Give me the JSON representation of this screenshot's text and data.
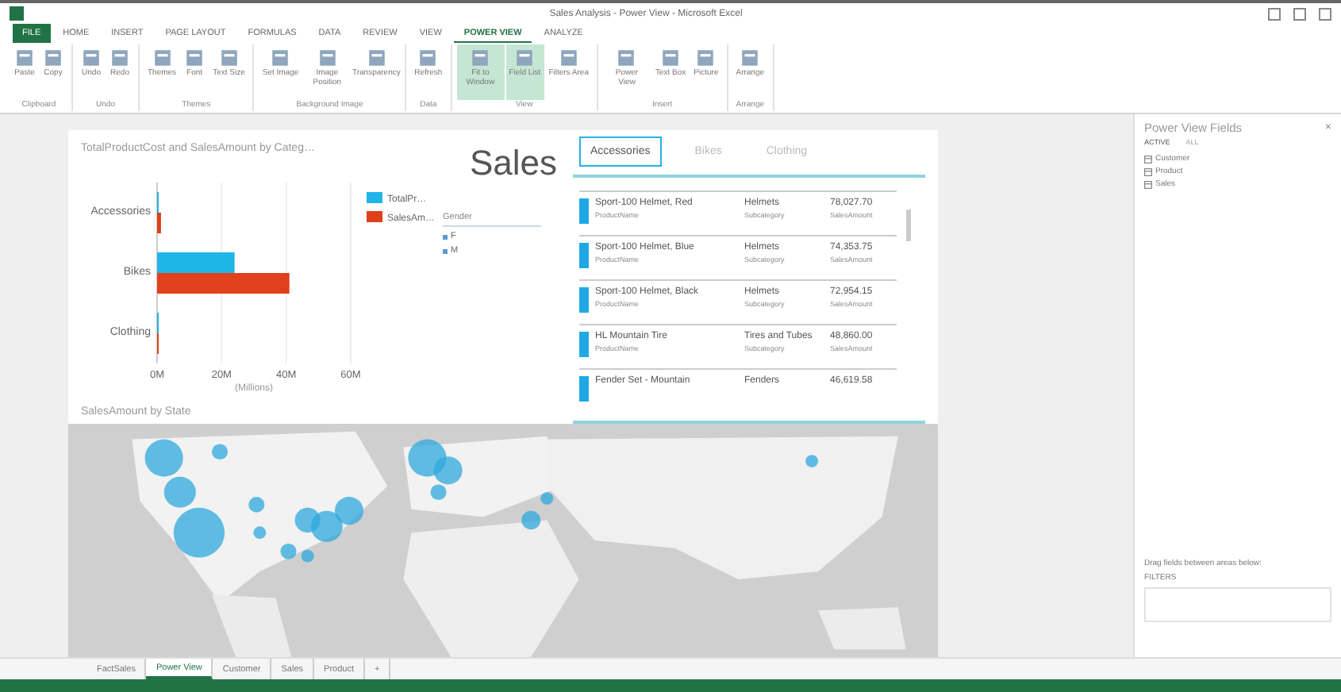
{
  "window": {
    "title": "Sales Analysis - Power View - Microsoft Excel"
  },
  "ribbon_tabs": [
    {
      "label": "FILE",
      "selected": false,
      "kind": "file"
    },
    {
      "label": "HOME",
      "selected": false,
      "kind": "tab"
    },
    {
      "label": "INSERT",
      "selected": false,
      "kind": "tab"
    },
    {
      "label": "PAGE LAYOUT",
      "selected": false,
      "kind": "tab"
    },
    {
      "label": "FORMULAS",
      "selected": false,
      "kind": "tab"
    },
    {
      "label": "DATA",
      "selected": false,
      "kind": "tab"
    },
    {
      "label": "REVIEW",
      "selected": false,
      "kind": "tab"
    },
    {
      "label": "VIEW",
      "selected": false,
      "kind": "tab"
    },
    {
      "label": "POWER VIEW",
      "selected": true,
      "kind": "tab"
    },
    {
      "label": "ANALYZE",
      "selected": false,
      "kind": "tab"
    }
  ],
  "ribbon_groups": [
    {
      "name": "Clipboard",
      "buttons": [
        {
          "label": "Paste",
          "on": false
        },
        {
          "label": "Copy",
          "on": false
        }
      ]
    },
    {
      "name": "Undo",
      "buttons": [
        {
          "label": "Undo",
          "on": false
        },
        {
          "label": "Redo",
          "on": false
        }
      ]
    },
    {
      "name": "Themes",
      "buttons": [
        {
          "label": "Themes",
          "on": false
        },
        {
          "label": "Font",
          "on": false
        },
        {
          "label": "Text Size",
          "on": false
        }
      ]
    },
    {
      "name": "Background Image",
      "buttons": [
        {
          "label": "Set Image",
          "on": false
        },
        {
          "label": "Image Position",
          "on": false
        },
        {
          "label": "Transparency",
          "on": false
        }
      ]
    },
    {
      "name": "Data",
      "buttons": [
        {
          "label": "Refresh",
          "on": false
        }
      ]
    },
    {
      "name": "View",
      "buttons": [
        {
          "label": "Fit to Window",
          "on": true
        },
        {
          "label": "Field List",
          "on": true
        },
        {
          "label": "Filters Area",
          "on": false
        }
      ]
    },
    {
      "name": "Insert",
      "buttons": [
        {
          "label": "Power View",
          "on": false
        },
        {
          "label": "Text Box",
          "on": false
        },
        {
          "label": "Picture",
          "on": false
        }
      ]
    },
    {
      "name": "Arrange",
      "buttons": [
        {
          "label": "Arrange",
          "on": false
        }
      ]
    }
  ],
  "report": {
    "title": "Sales",
    "bar_chart": {
      "chart_data": {
        "type": "bar",
        "orientation": "horizontal",
        "title": "TotalProductCost and SalesAmount by Categ…",
        "xlabel": "(Millions)",
        "categories": [
          "Accessories",
          "Bikes",
          "Clothing"
        ],
        "series": [
          {
            "name": "TotalPr…",
            "color": "#1fb5e8",
            "values": [
              0.5,
              24,
              0.3
            ]
          },
          {
            "name": "SalesAm…",
            "color": "#e0401c",
            "values": [
              1.2,
              41,
              0.4
            ]
          }
        ],
        "xlim": [
          0,
          60
        ],
        "xticks": [
          {
            "value": 0,
            "label": "0M"
          },
          {
            "value": 20,
            "label": "20M"
          },
          {
            "value": 40,
            "label": "40M"
          },
          {
            "value": 60,
            "label": "60M"
          }
        ],
        "legend": "right"
      }
    },
    "slicer": {
      "title": "Gender",
      "items": [
        {
          "label": "F",
          "selected": false
        },
        {
          "label": "M",
          "selected": false
        }
      ]
    },
    "tile_tabs": [
      {
        "label": "Accessories",
        "selected": true
      },
      {
        "label": "Bikes",
        "selected": false
      },
      {
        "label": "Clothing",
        "selected": false
      }
    ],
    "cards": [
      {
        "name": "Sport-100 Helmet, Red",
        "category": "Helmets",
        "amount": "78,027.70",
        "captions": [
          "ProductName",
          "Subcategory",
          "SalesAmount"
        ]
      },
      {
        "name": "Sport-100 Helmet, Blue",
        "category": "Helmets",
        "amount": "74,353.75",
        "captions": [
          "ProductName",
          "Subcategory",
          "SalesAmount"
        ]
      },
      {
        "name": "Sport-100 Helmet, Black",
        "category": "Helmets",
        "amount": "72,954.15",
        "captions": [
          "ProductName",
          "Subcategory",
          "SalesAmount"
        ]
      },
      {
        "name": "HL Mountain Tire",
        "category": "Tires and Tubes",
        "amount": "48,860.00",
        "captions": [
          "ProductName",
          "Subcategory",
          "SalesAmount"
        ]
      },
      {
        "name": "Fender Set - Mountain",
        "category": "Fenders",
        "amount": "46,619.58"
      }
    ],
    "map": {
      "title": "SalesAmount by State",
      "kind": "picture"
    }
  },
  "field_pane": {
    "title": "Power View Fields",
    "close": "×",
    "tabs": [
      {
        "label": "ACTIVE",
        "selected": true
      },
      {
        "label": "ALL",
        "selected": false
      }
    ],
    "tables": [
      "Customer",
      "Product",
      "Sales"
    ],
    "hint": "Drag fields between areas below:",
    "area": "FILTERS"
  },
  "sheet_tabs": [
    {
      "label": "FactSales",
      "selected": false
    },
    {
      "label": "Power View",
      "selected": true
    },
    {
      "label": "Customer",
      "selected": false
    },
    {
      "label": "Sales",
      "selected": false
    },
    {
      "label": "Product",
      "selected": false
    }
  ],
  "add_sheet": "+"
}
